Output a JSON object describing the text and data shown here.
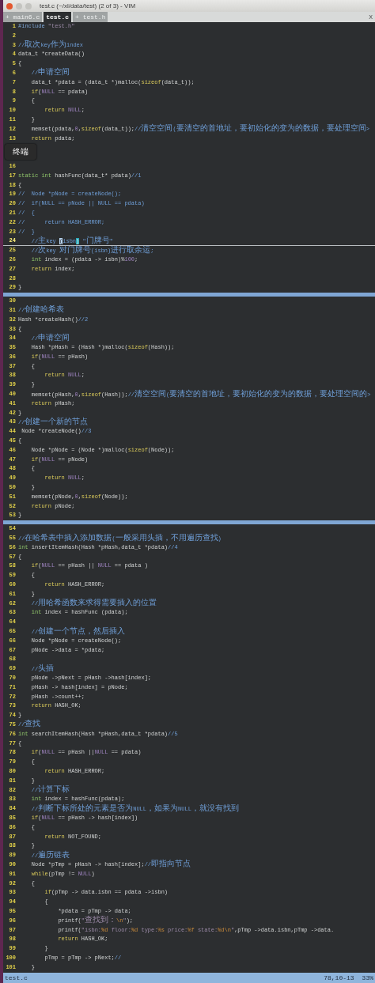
{
  "window": {
    "title": "test.c (~/xl/data/test) (2 of 3) - VIM"
  },
  "tabs": [
    {
      "label": "+ main6.c",
      "selected": false
    },
    {
      "label": "test.c",
      "selected": true
    },
    {
      "label": "+ test.h",
      "selected": false
    }
  ],
  "tab_close": "X",
  "tooltip": {
    "text": "终端"
  },
  "windows": [
    {
      "lines": [
        {
          "num": "1",
          "current": false,
          "code": [
            {
              "kind": "preproc",
              "text": "#include"
            },
            {
              "kind": "string",
              "text": " \"test.h\""
            }
          ]
        },
        {
          "num": "2",
          "current": false
        },
        {
          "num": "3",
          "current": false,
          "code": [
            {
              "kind": "comment",
              "text": "//取次key作为index"
            }
          ]
        },
        {
          "num": "4",
          "current": false,
          "code": [
            {
              "kind": "plain",
              "text": "data_t *createData()"
            }
          ]
        },
        {
          "num": "5",
          "current": false,
          "code": [
            {
              "kind": "plain",
              "text": "{"
            }
          ]
        },
        {
          "num": "6",
          "current": false,
          "code": [
            {
              "kind": "comment",
              "text": "    //申请空间"
            }
          ]
        },
        {
          "num": "7",
          "current": false,
          "code": [
            {
              "kind": "plain",
              "text": "    data_t *pdata = (data_t *)malloc("
            },
            {
              "kind": "keyword",
              "text": "sizeof"
            },
            {
              "kind": "plain",
              "text": "(data_t));"
            }
          ]
        },
        {
          "num": "8",
          "current": false,
          "code": [
            {
              "kind": "keyword",
              "text": "    if"
            },
            {
              "kind": "plain",
              "text": "("
            },
            {
              "kind": "constant",
              "text": "NULL"
            },
            {
              "kind": "plain",
              "text": " == pdata)"
            }
          ]
        },
        {
          "num": "9",
          "current": false,
          "code": [
            {
              "kind": "plain",
              "text": "    {"
            }
          ]
        },
        {
          "num": "10",
          "current": false,
          "code": [
            {
              "kind": "keyword",
              "text": "        return"
            },
            {
              "kind": "constant",
              "text": " NULL"
            },
            {
              "kind": "plain",
              "text": ";"
            }
          ]
        },
        {
          "num": "11",
          "current": false,
          "code": [
            {
              "kind": "plain",
              "text": "    }"
            }
          ]
        },
        {
          "num": "12",
          "current": false,
          "code": [
            {
              "kind": "plain",
              "text": "    memset(pdata,"
            },
            {
              "kind": "constant",
              "text": "0"
            },
            {
              "kind": "plain",
              "text": ","
            },
            {
              "kind": "keyword",
              "text": "sizeof"
            },
            {
              "kind": "plain",
              "text": "(data_t));"
            },
            {
              "kind": "comment",
              "text": "//清空空间(要清空的首地址，要初始化的变为的数据，要处理空间>"
            }
          ]
        },
        {
          "num": "13",
          "current": false,
          "code": [
            {
              "kind": "keyword",
              "text": "    return"
            },
            {
              "kind": "plain",
              "text": " pdata;"
            }
          ]
        },
        {
          "current": false
        },
        {
          "current": false
        },
        {
          "num": "16",
          "current": false
        },
        {
          "num": "17",
          "current": false,
          "code": [
            {
              "kind": "type",
              "text": "static int"
            },
            {
              "kind": "plain",
              "text": " hashFunc(data_t* pdata)"
            },
            {
              "kind": "comment",
              "text": "//1"
            }
          ]
        },
        {
          "num": "18",
          "current": false,
          "code": [
            {
              "kind": "plain",
              "text": "{"
            }
          ]
        },
        {
          "num": "19",
          "current": false,
          "code": [
            {
              "kind": "comment",
              "text": "//  Node *pNode = createNode();"
            }
          ]
        },
        {
          "num": "20",
          "current": false,
          "code": [
            {
              "kind": "comment",
              "text": "//  if(NULL == pNode || NULL == pdata)"
            }
          ]
        },
        {
          "num": "21",
          "current": false,
          "code": [
            {
              "kind": "comment",
              "text": "//  {"
            }
          ]
        },
        {
          "num": "22",
          "current": false,
          "code": [
            {
              "kind": "comment",
              "text": "//      return HASH_ERROR;"
            }
          ]
        },
        {
          "num": "23",
          "current": false,
          "code": [
            {
              "kind": "comment",
              "text": "//  }"
            }
          ]
        },
        {
          "num": "24",
          "current": true,
          "code": [
            {
              "kind": "comment",
              "text": "    //主key "
            },
            {
              "kind": "cursor",
              "text": "("
            },
            {
              "kind": "comment",
              "text": "isbn"
            },
            {
              "kind": "match",
              "text": ")"
            },
            {
              "kind": "comment",
              "text": " \"门牌号\""
            }
          ]
        },
        {
          "num": "25",
          "current": false,
          "code": [
            {
              "kind": "comment",
              "text": "    //次key 对门牌号(isbn)进行取余运;"
            }
          ]
        },
        {
          "num": "26",
          "current": false,
          "code": [
            {
              "kind": "type",
              "text": "    int"
            },
            {
              "kind": "plain",
              "text": " index = (pdata -> isbn)%"
            },
            {
              "kind": "constant",
              "text": "100"
            },
            {
              "kind": "plain",
              "text": ";"
            }
          ]
        },
        {
          "num": "27",
          "current": false,
          "code": [
            {
              "kind": "keyword",
              "text": "    return"
            },
            {
              "kind": "plain",
              "text": " index;"
            }
          ]
        },
        {
          "num": "28",
          "current": false
        },
        {
          "num": "29",
          "current": false,
          "code": [
            {
              "kind": "plain",
              "text": "}"
            }
          ]
        }
      ]
    },
    {
      "lines": [
        {
          "num": "30",
          "current": false
        },
        {
          "num": "31",
          "current": false,
          "code": [
            {
              "kind": "comment",
              "text": "//创建哈希表"
            }
          ]
        },
        {
          "num": "32",
          "current": false,
          "code": [
            {
              "kind": "plain",
              "text": "Hash *createHash()"
            },
            {
              "kind": "comment",
              "text": "//2"
            }
          ]
        },
        {
          "num": "33",
          "current": false,
          "code": [
            {
              "kind": "plain",
              "text": "{"
            }
          ]
        },
        {
          "num": "34",
          "current": false,
          "code": [
            {
              "kind": "comment",
              "text": "    //申请空间"
            }
          ]
        },
        {
          "num": "35",
          "current": false,
          "code": [
            {
              "kind": "plain",
              "text": "    Hash *pHash = (Hash *)malloc("
            },
            {
              "kind": "keyword",
              "text": "sizeof"
            },
            {
              "kind": "plain",
              "text": "(Hash));"
            }
          ]
        },
        {
          "num": "36",
          "current": false,
          "code": [
            {
              "kind": "keyword",
              "text": "    if"
            },
            {
              "kind": "plain",
              "text": "("
            },
            {
              "kind": "constant",
              "text": "NULL"
            },
            {
              "kind": "plain",
              "text": " == pHash)"
            }
          ]
        },
        {
          "num": "37",
          "current": false,
          "code": [
            {
              "kind": "plain",
              "text": "    {"
            }
          ]
        },
        {
          "num": "38",
          "current": false,
          "code": [
            {
              "kind": "keyword",
              "text": "        return"
            },
            {
              "kind": "constant",
              "text": " NULL"
            },
            {
              "kind": "plain",
              "text": ";"
            }
          ]
        },
        {
          "num": "39",
          "current": false,
          "code": [
            {
              "kind": "plain",
              "text": "    }"
            }
          ]
        },
        {
          "num": "40",
          "current": false,
          "code": [
            {
              "kind": "plain",
              "text": "    memset(pHash,"
            },
            {
              "kind": "constant",
              "text": "0"
            },
            {
              "kind": "plain",
              "text": ","
            },
            {
              "kind": "keyword",
              "text": "sizeof"
            },
            {
              "kind": "plain",
              "text": "(Hash));"
            },
            {
              "kind": "comment",
              "text": "//清空空间(要清空的首地址，要初始化的变为的数据，要处理空间的>"
            }
          ]
        },
        {
          "num": "41",
          "current": false,
          "code": [
            {
              "kind": "keyword",
              "text": "    return"
            },
            {
              "kind": "plain",
              "text": " pHash;"
            }
          ]
        },
        {
          "num": "42",
          "current": false,
          "code": [
            {
              "kind": "plain",
              "text": "}"
            }
          ]
        },
        {
          "num": "43",
          "current": false,
          "code": [
            {
              "kind": "comment",
              "text": "//创建一个新的节点"
            }
          ]
        },
        {
          "num": "44",
          "current": false,
          "code": [
            {
              "kind": "plain",
              "text": " Node *createNode()"
            },
            {
              "kind": "comment",
              "text": "//3"
            }
          ]
        },
        {
          "num": "45",
          "current": false,
          "code": [
            {
              "kind": "plain",
              "text": "{"
            }
          ]
        },
        {
          "num": "46",
          "current": false,
          "code": [
            {
              "kind": "plain",
              "text": "    Node *pNode = (Node *)malloc("
            },
            {
              "kind": "keyword",
              "text": "sizeof"
            },
            {
              "kind": "plain",
              "text": "(Node));"
            }
          ]
        },
        {
          "num": "47",
          "current": false,
          "code": [
            {
              "kind": "keyword",
              "text": "    if"
            },
            {
              "kind": "plain",
              "text": "("
            },
            {
              "kind": "constant",
              "text": "NULL"
            },
            {
              "kind": "plain",
              "text": " == pNode)"
            }
          ]
        },
        {
          "num": "48",
          "current": false,
          "code": [
            {
              "kind": "plain",
              "text": "    {"
            }
          ]
        },
        {
          "num": "49",
          "current": false,
          "code": [
            {
              "kind": "keyword",
              "text": "        return"
            },
            {
              "kind": "constant",
              "text": " NULL"
            },
            {
              "kind": "plain",
              "text": ";"
            }
          ]
        },
        {
          "num": "50",
          "current": false,
          "code": [
            {
              "kind": "plain",
              "text": "    }"
            }
          ]
        },
        {
          "num": "51",
          "current": false,
          "code": [
            {
              "kind": "plain",
              "text": "    memset(pNode,"
            },
            {
              "kind": "constant",
              "text": "0"
            },
            {
              "kind": "plain",
              "text": ","
            },
            {
              "kind": "keyword",
              "text": "sizeof"
            },
            {
              "kind": "plain",
              "text": "(Node));"
            }
          ]
        },
        {
          "num": "52",
          "current": false,
          "code": [
            {
              "kind": "keyword",
              "text": "    return"
            },
            {
              "kind": "plain",
              "text": " pNode;"
            }
          ]
        },
        {
          "num": "53",
          "current": false,
          "code": [
            {
              "kind": "plain",
              "text": "}"
            }
          ]
        }
      ]
    },
    {
      "lines": [
        {
          "num": "54",
          "current": false
        },
        {
          "num": "55",
          "current": false,
          "code": [
            {
              "kind": "comment",
              "text": "//在哈希表中插入添加数据(一般采用头插，不用遍历查找)"
            }
          ]
        },
        {
          "num": "56",
          "current": false,
          "code": [
            {
              "kind": "type",
              "text": "int"
            },
            {
              "kind": "plain",
              "text": " insertItemHash(Hash *pHash,data_t *pdata)"
            },
            {
              "kind": "comment",
              "text": "//4"
            }
          ]
        },
        {
          "num": "57",
          "current": false,
          "code": [
            {
              "kind": "plain",
              "text": "{"
            }
          ]
        },
        {
          "num": "58",
          "current": false,
          "code": [
            {
              "kind": "keyword",
              "text": "    if"
            },
            {
              "kind": "plain",
              "text": "("
            },
            {
              "kind": "constant",
              "text": "NULL"
            },
            {
              "kind": "plain",
              "text": " == pHash || "
            },
            {
              "kind": "constant",
              "text": "NULL"
            },
            {
              "kind": "plain",
              "text": " == pdata )"
            }
          ]
        },
        {
          "num": "59",
          "current": false,
          "code": [
            {
              "kind": "plain",
              "text": "    {"
            }
          ]
        },
        {
          "num": "60",
          "current": false,
          "code": [
            {
              "kind": "keyword",
              "text": "        return"
            },
            {
              "kind": "plain",
              "text": " HASH_ERROR;"
            }
          ]
        },
        {
          "num": "61",
          "current": false,
          "code": [
            {
              "kind": "plain",
              "text": "    }"
            }
          ]
        },
        {
          "num": "62",
          "current": false,
          "code": [
            {
              "kind": "comment",
              "text": "    //用哈希函数来求得需要插入的位置"
            }
          ]
        },
        {
          "num": "63",
          "current": false,
          "code": [
            {
              "kind": "type",
              "text": "    int"
            },
            {
              "kind": "plain",
              "text": " index = hashFunc (pdata);"
            }
          ]
        },
        {
          "num": "64",
          "current": false
        },
        {
          "num": "65",
          "current": false,
          "code": [
            {
              "kind": "comment",
              "text": "    //创建一个节点，然后插入"
            }
          ]
        },
        {
          "num": "66",
          "current": false,
          "code": [
            {
              "kind": "plain",
              "text": "    Node *pNode = createNode();"
            }
          ]
        },
        {
          "num": "67",
          "current": false,
          "code": [
            {
              "kind": "plain",
              "text": "    pNode ->data = *pdata;"
            }
          ]
        },
        {
          "num": "68",
          "current": false
        },
        {
          "num": "69",
          "current": false,
          "code": [
            {
              "kind": "comment",
              "text": "    //头插"
            }
          ]
        },
        {
          "num": "70",
          "current": false,
          "code": [
            {
              "kind": "plain",
              "text": "    pNode ->pNext = pHash ->hash[index];"
            }
          ]
        },
        {
          "num": "71",
          "current": false,
          "code": [
            {
              "kind": "plain",
              "text": "    pHash -> hash[index] = pNode;"
            }
          ]
        },
        {
          "num": "72",
          "current": false,
          "code": [
            {
              "kind": "plain",
              "text": "    pHash ->count++;"
            }
          ]
        },
        {
          "num": "73",
          "current": false,
          "code": [
            {
              "kind": "keyword",
              "text": "    return"
            },
            {
              "kind": "plain",
              "text": " HASH_OK;"
            }
          ]
        },
        {
          "num": "74",
          "current": false,
          "code": [
            {
              "kind": "plain",
              "text": "}"
            }
          ]
        },
        {
          "num": "75",
          "current": false,
          "code": [
            {
              "kind": "comment",
              "text": "//查找"
            }
          ]
        },
        {
          "num": "76",
          "current": false,
          "code": [
            {
              "kind": "type",
              "text": "int"
            },
            {
              "kind": "plain",
              "text": " searchItemHash(Hash *pHash,data_t *pdata)"
            },
            {
              "kind": "comment",
              "text": "//5"
            }
          ]
        },
        {
          "num": "77",
          "current": false,
          "code": [
            {
              "kind": "plain",
              "text": "{"
            }
          ]
        },
        {
          "num": "78",
          "current": false,
          "code": [
            {
              "kind": "keyword",
              "text": "    if"
            },
            {
              "kind": "plain",
              "text": "("
            },
            {
              "kind": "constant",
              "text": "NULL"
            },
            {
              "kind": "plain",
              "text": " == pHash ||"
            },
            {
              "kind": "constant",
              "text": "NULL"
            },
            {
              "kind": "plain",
              "text": " == pdata)"
            }
          ]
        },
        {
          "num": "79",
          "current": false,
          "code": [
            {
              "kind": "plain",
              "text": "    {"
            }
          ]
        },
        {
          "num": "80",
          "current": false,
          "code": [
            {
              "kind": "keyword",
              "text": "        return"
            },
            {
              "kind": "plain",
              "text": " HASH_ERROR;"
            }
          ]
        },
        {
          "num": "81",
          "current": false,
          "code": [
            {
              "kind": "plain",
              "text": "    }"
            }
          ]
        },
        {
          "num": "82",
          "current": false,
          "code": [
            {
              "kind": "comment",
              "text": "    //计算下标"
            }
          ]
        },
        {
          "num": "83",
          "current": false,
          "code": [
            {
              "kind": "type",
              "text": "    int"
            },
            {
              "kind": "plain",
              "text": " index = hashFunc(pdata);"
            }
          ]
        },
        {
          "num": "84",
          "current": false,
          "code": [
            {
              "kind": "comment",
              "text": "    //判断下标所处的元素是否为NULL，如果为NULL，就没有找到"
            }
          ]
        },
        {
          "num": "85",
          "current": false,
          "code": [
            {
              "kind": "keyword",
              "text": "    if"
            },
            {
              "kind": "plain",
              "text": "("
            },
            {
              "kind": "constant",
              "text": "NULL"
            },
            {
              "kind": "plain",
              "text": " == pHash -> hash[index])"
            }
          ]
        },
        {
          "num": "86",
          "current": false,
          "code": [
            {
              "kind": "plain",
              "text": "    {"
            }
          ]
        },
        {
          "num": "87",
          "current": false,
          "code": [
            {
              "kind": "keyword",
              "text": "        return"
            },
            {
              "kind": "plain",
              "text": " NOT_FOUND;"
            }
          ]
        },
        {
          "num": "88",
          "current": false,
          "code": [
            {
              "kind": "plain",
              "text": "    }"
            }
          ]
        },
        {
          "num": "89",
          "current": false,
          "code": [
            {
              "kind": "comment",
              "text": "    //遍历链表"
            }
          ]
        },
        {
          "num": "90",
          "current": false,
          "code": [
            {
              "kind": "plain",
              "text": "    Node *pTmp = pHash -> hash[index];"
            },
            {
              "kind": "comment",
              "text": "//即指向节点"
            }
          ]
        },
        {
          "num": "91",
          "current": false,
          "code": [
            {
              "kind": "keyword",
              "text": "    while"
            },
            {
              "kind": "plain",
              "text": "(pTmp != "
            },
            {
              "kind": "constant",
              "text": "NULL"
            },
            {
              "kind": "plain",
              "text": ")"
            }
          ]
        },
        {
          "num": "92",
          "current": false,
          "code": [
            {
              "kind": "plain",
              "text": "    {"
            }
          ]
        },
        {
          "num": "93",
          "current": false,
          "code": [
            {
              "kind": "keyword",
              "text": "        if"
            },
            {
              "kind": "plain",
              "text": "(pTmp -> data.isbn == pdata ->isbn)"
            }
          ]
        },
        {
          "num": "94",
          "current": false,
          "code": [
            {
              "kind": "plain",
              "text": "        {"
            }
          ]
        },
        {
          "num": "95",
          "current": false,
          "code": [
            {
              "kind": "plain",
              "text": "            *pdata = pTmp -> data;"
            }
          ]
        },
        {
          "num": "96",
          "current": false,
          "code": [
            {
              "kind": "plain",
              "text": "            printf("
            },
            {
              "kind": "string",
              "text": "\"查找到："
            },
            {
              "kind": "special",
              "text": "\\n"
            },
            {
              "kind": "string",
              "text": "\""
            },
            {
              "kind": "plain",
              "text": ");"
            }
          ]
        },
        {
          "num": "97",
          "current": false,
          "code": [
            {
              "kind": "plain",
              "text": "            printf("
            },
            {
              "kind": "string",
              "text": "\"isbn:"
            },
            {
              "kind": "special",
              "text": "%d"
            },
            {
              "kind": "string",
              "text": " floor:"
            },
            {
              "kind": "special",
              "text": "%d"
            },
            {
              "kind": "string",
              "text": " type:"
            },
            {
              "kind": "special",
              "text": "%s"
            },
            {
              "kind": "string",
              "text": " price:"
            },
            {
              "kind": "special",
              "text": "%f"
            },
            {
              "kind": "string",
              "text": " state:"
            },
            {
              "kind": "special",
              "text": "%d\\n"
            },
            {
              "kind": "string",
              "text": "\""
            },
            {
              "kind": "plain",
              "text": ",pTmp ->data.isbn,pTmp ->data."
            }
          ]
        },
        {
          "num": "98",
          "current": false,
          "code": [
            {
              "kind": "keyword",
              "text": "            return"
            },
            {
              "kind": "plain",
              "text": " HASH_OK;"
            }
          ]
        },
        {
          "num": "99",
          "current": false,
          "code": [
            {
              "kind": "plain",
              "text": "        }"
            }
          ]
        },
        {
          "num": "100",
          "current": false,
          "code": [
            {
              "kind": "plain",
              "text": "        pTmp = pTmp -> pNext;"
            },
            {
              "kind": "comment",
              "text": "//"
            }
          ]
        },
        {
          "num": "101",
          "current": false,
          "code": [
            {
              "kind": "plain",
              "text": "    }"
            }
          ]
        }
      ]
    }
  ],
  "status_line": {
    "file": "test.c",
    "position": "78,10-13",
    "percent": "33%"
  }
}
